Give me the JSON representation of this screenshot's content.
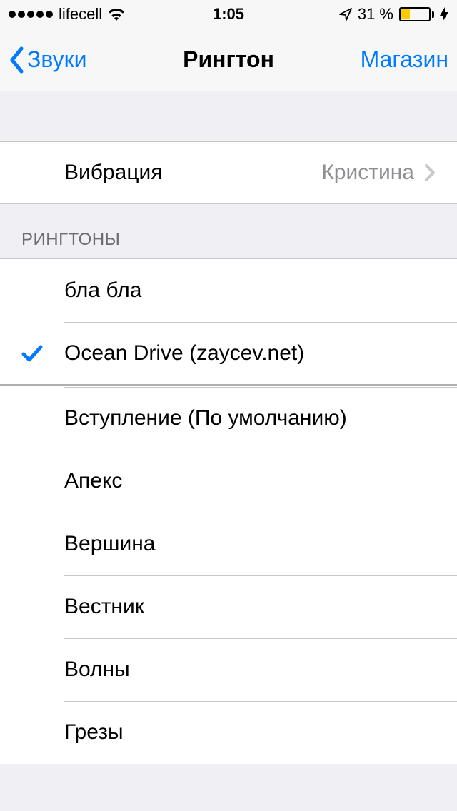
{
  "status": {
    "carrier": "lifecell",
    "time": "1:05",
    "battery_pct": "31 %"
  },
  "nav": {
    "back": "Звуки",
    "title": "Рингтон",
    "right": "Магазин"
  },
  "vibration": {
    "label": "Вибрация",
    "value": "Кристина"
  },
  "section_header": "РИНГТОНЫ",
  "ringtones": [
    {
      "label": "бла бла",
      "selected": false
    },
    {
      "label": "Ocean Drive (zaycev.net)",
      "selected": true
    },
    {
      "label": "Вступление (По умолчанию)",
      "selected": false
    },
    {
      "label": "Апекс",
      "selected": false
    },
    {
      "label": "Вершина",
      "selected": false
    },
    {
      "label": "Вестник",
      "selected": false
    },
    {
      "label": "Волны",
      "selected": false
    },
    {
      "label": "Грезы",
      "selected": false
    }
  ],
  "colors": {
    "tint": "#007aff",
    "battery_fill": "#ffcc00"
  }
}
